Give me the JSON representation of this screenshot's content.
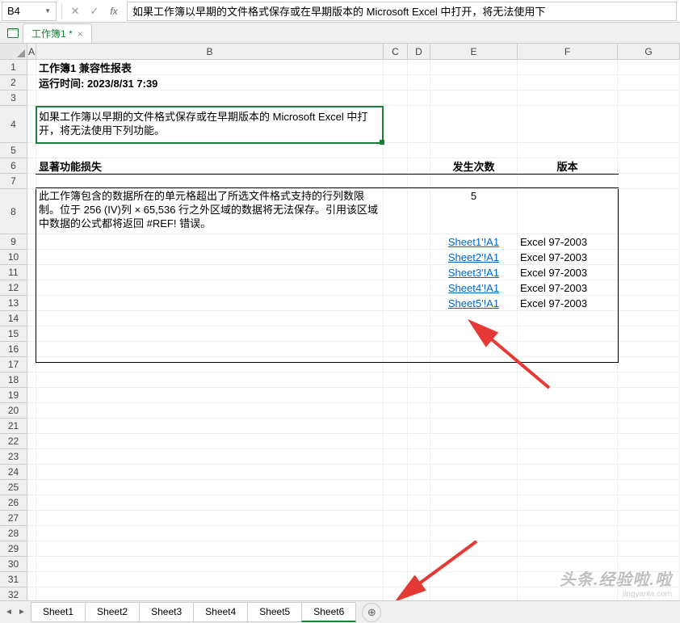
{
  "nameBox": "B4",
  "formulaText": "如果工作簿以早期的文件格式保存或在早期版本的 Microsoft Excel 中打开，将无法使用下",
  "fileTab": "工作簿1 *",
  "columns": [
    "A",
    "B",
    "C",
    "D",
    "E",
    "F",
    "G"
  ],
  "rowNumbers": [
    "1",
    "2",
    "3",
    "4",
    "5",
    "6",
    "7",
    "8",
    "9",
    "10",
    "11",
    "12",
    "13",
    "14",
    "15",
    "16",
    "17",
    "18",
    "19",
    "20",
    "21",
    "22",
    "23",
    "24",
    "25",
    "26",
    "27",
    "28",
    "29",
    "30",
    "31",
    "32"
  ],
  "report": {
    "title": "工作簿1 兼容性报表",
    "runtime": "运行时间: 2023/8/31 7:39",
    "notice": "如果工作簿以早期的文件格式保存或在早期版本的 Microsoft Excel 中打开，将无法使用下列功能。",
    "header1": "显著功能损失",
    "header2": "发生次数",
    "header3": "版本",
    "issue": "此工作簿包含的数据所在的单元格超出了所选文件格式支持的行列数限制。位于 256 (IV)列 × 65,536 行之外区域的数据将无法保存。引用该区域中数据的公式都将返回 #REF! 错误。",
    "count": "5",
    "links": [
      {
        "ref": "Sheet1'!A1",
        "ver": "Excel 97-2003"
      },
      {
        "ref": "Sheet2'!A1",
        "ver": "Excel 97-2003"
      },
      {
        "ref": "Sheet3'!A1",
        "ver": "Excel 97-2003"
      },
      {
        "ref": "Sheet4'!A1",
        "ver": "Excel 97-2003"
      },
      {
        "ref": "Sheet5'!A1",
        "ver": "Excel 97-2003"
      }
    ]
  },
  "sheets": [
    "Sheet1",
    "Sheet2",
    "Sheet3",
    "Sheet4",
    "Sheet5",
    "Sheet6"
  ],
  "activeSheet": 5,
  "watermark": {
    "main": "头条.经验啦.啦",
    "sub": "jingyanla.com"
  }
}
